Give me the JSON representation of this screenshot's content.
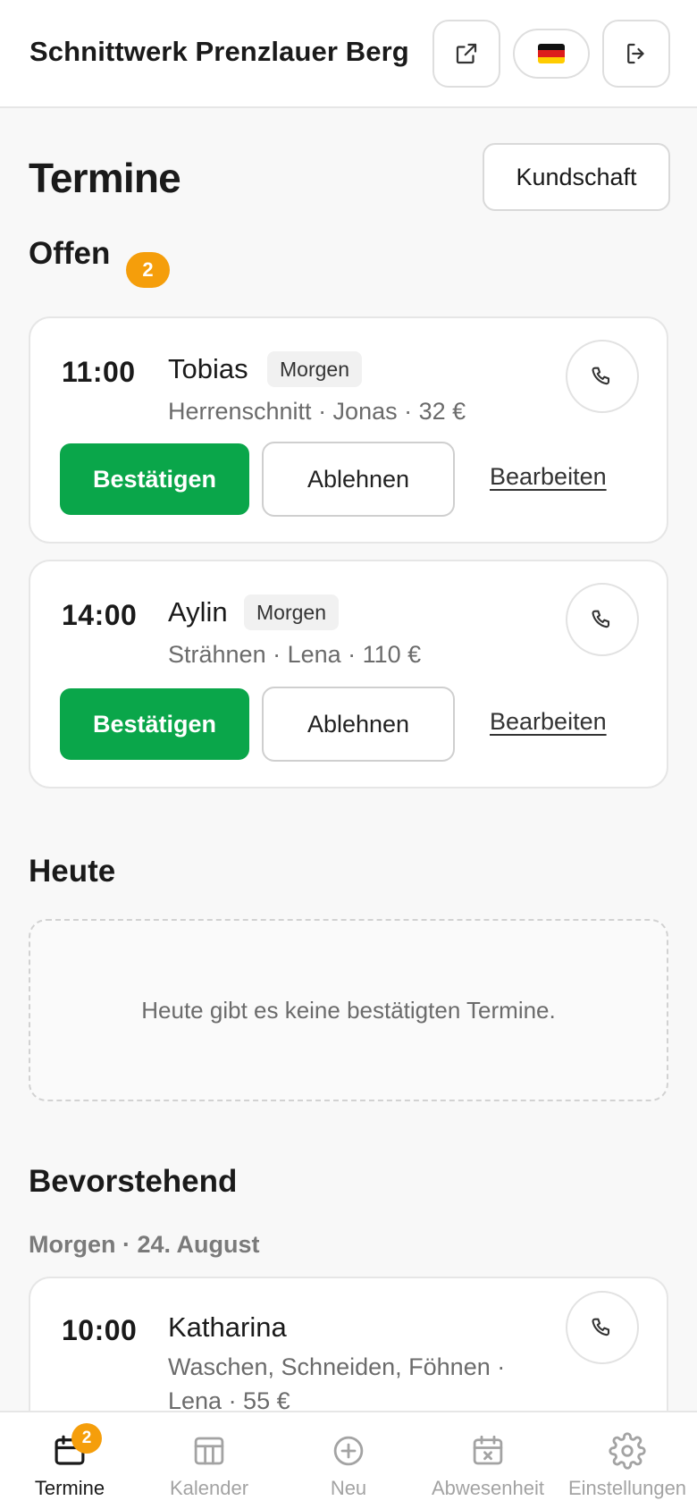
{
  "header": {
    "brand": "Schnittwerk Prenzlauer Berg",
    "icons": [
      "external-link-icon",
      "german-flag-icon",
      "logout-icon"
    ]
  },
  "page": {
    "title": "Termine",
    "customer_button": "Kundschaft"
  },
  "open": {
    "title": "Offen",
    "count": "2",
    "appointments": [
      {
        "time": "11:00",
        "name": "Tobias",
        "tag": "Morgen",
        "meta": "Herrenschnitt · Jonas · 32 €",
        "confirm": "Bestätigen",
        "reject": "Ablehnen",
        "edit": "Bearbeiten"
      },
      {
        "time": "14:00",
        "name": "Aylin",
        "tag": "Morgen",
        "meta": "Strähnen · Lena · 110 €",
        "confirm": "Bestätigen",
        "reject": "Ablehnen",
        "edit": "Bearbeiten"
      }
    ]
  },
  "today": {
    "title": "Heute",
    "empty_text": "Heute gibt es keine bestätigten Termine."
  },
  "upcoming": {
    "title": "Bevorstehend",
    "day_label": "Morgen · 24. August",
    "appointments": [
      {
        "time": "10:00",
        "name": "Katharina",
        "meta_line1": "Waschen, Schneiden, Föhnen ·",
        "meta_line2": "Lena · 55 €"
      }
    ]
  },
  "nav": {
    "items": [
      {
        "label": "Termine",
        "icon": "calendar-icon",
        "badge": "2",
        "active": true
      },
      {
        "label": "Kalender",
        "icon": "calendar-grid-icon",
        "active": false
      },
      {
        "label": "Neu",
        "icon": "plus-circle-icon",
        "active": false
      },
      {
        "label": "Abwesenheit",
        "icon": "calendar-x-icon",
        "active": false
      },
      {
        "label": "Einstellungen",
        "icon": "gear-icon",
        "active": false
      }
    ]
  },
  "colors": {
    "accent_green": "#0aa64a",
    "badge_orange": "#f59e0b",
    "background": "#f8f8f8"
  }
}
